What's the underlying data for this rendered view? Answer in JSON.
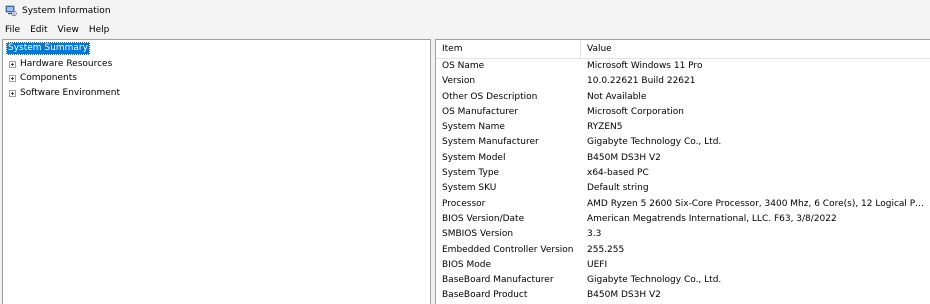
{
  "window": {
    "title": "System Information",
    "icon": "system-information-icon"
  },
  "menu": [
    "File",
    "Edit",
    "View",
    "Help"
  ],
  "tree": {
    "root": "System Summary",
    "children": [
      "Hardware Resources",
      "Components",
      "Software Environment"
    ]
  },
  "list": {
    "columns": [
      "Item",
      "Value"
    ],
    "rows": [
      {
        "item": "OS Name",
        "value": "Microsoft Windows 11 Pro"
      },
      {
        "item": "Version",
        "value": "10.0.22621 Build 22621"
      },
      {
        "item": "Other OS Description",
        "value": "Not Available"
      },
      {
        "item": "OS Manufacturer",
        "value": "Microsoft Corporation"
      },
      {
        "item": "System Name",
        "value": "RYZEN5"
      },
      {
        "item": "System Manufacturer",
        "value": "Gigabyte Technology Co., Ltd."
      },
      {
        "item": "System Model",
        "value": "B450M DS3H V2"
      },
      {
        "item": "System Type",
        "value": "x64-based PC"
      },
      {
        "item": "System SKU",
        "value": "Default string"
      },
      {
        "item": "Processor",
        "value": "AMD Ryzen 5 2600 Six-Core Processor, 3400 Mhz, 6 Core(s), 12 Logical Proce..."
      },
      {
        "item": "BIOS Version/Date",
        "value": "American Megatrends International, LLC. F63, 3/8/2022"
      },
      {
        "item": "SMBIOS Version",
        "value": "3.3"
      },
      {
        "item": "Embedded Controller Version",
        "value": "255.255"
      },
      {
        "item": "BIOS Mode",
        "value": "UEFI"
      },
      {
        "item": "BaseBoard Manufacturer",
        "value": "Gigabyte Technology Co., Ltd."
      },
      {
        "item": "BaseBoard Product",
        "value": "B450M DS3H V2"
      }
    ]
  },
  "colors": {
    "selection": "#0078d7",
    "pane_border": "#a0a0a0",
    "background": "#f0f0f0"
  }
}
